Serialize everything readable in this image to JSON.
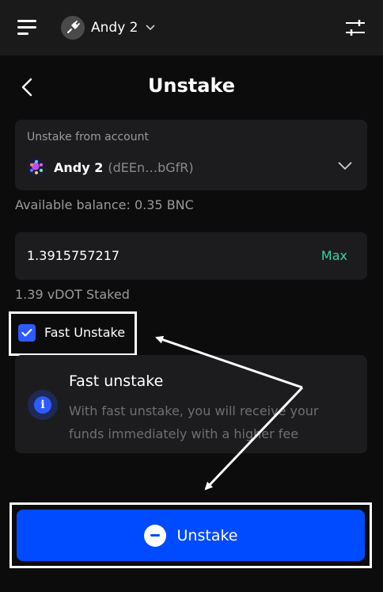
{
  "header": {
    "account_name": "Andy 2",
    "icons": [
      "menu-icon",
      "plug-icon",
      "chevron-down-icon",
      "sliders-icon"
    ]
  },
  "page": {
    "title": "Unstake"
  },
  "unstake_from": {
    "label": "Unstake from account",
    "account_name": "Andy 2",
    "account_address": "(dEEn…bGfR)"
  },
  "balance": {
    "text": "Available balance: 0.35 BNC"
  },
  "amount": {
    "value": "1.3915757217",
    "max_label": "Max"
  },
  "staked": {
    "text": "1.39 vDOT Staked"
  },
  "fast_unstake": {
    "label": "Fast Unstake",
    "checked": true
  },
  "info": {
    "title": "Fast unstake",
    "text": "With fast unstake, you will receive your funds immediately with a higher fee"
  },
  "action": {
    "unstake_label": "Unstake"
  },
  "colors": {
    "accent_blue": "#004bff",
    "checkbox_blue": "#2d5bff",
    "max_green": "#39d49b",
    "card_bg": "#1c1c1e",
    "page_bg": "#0c0c0c"
  }
}
